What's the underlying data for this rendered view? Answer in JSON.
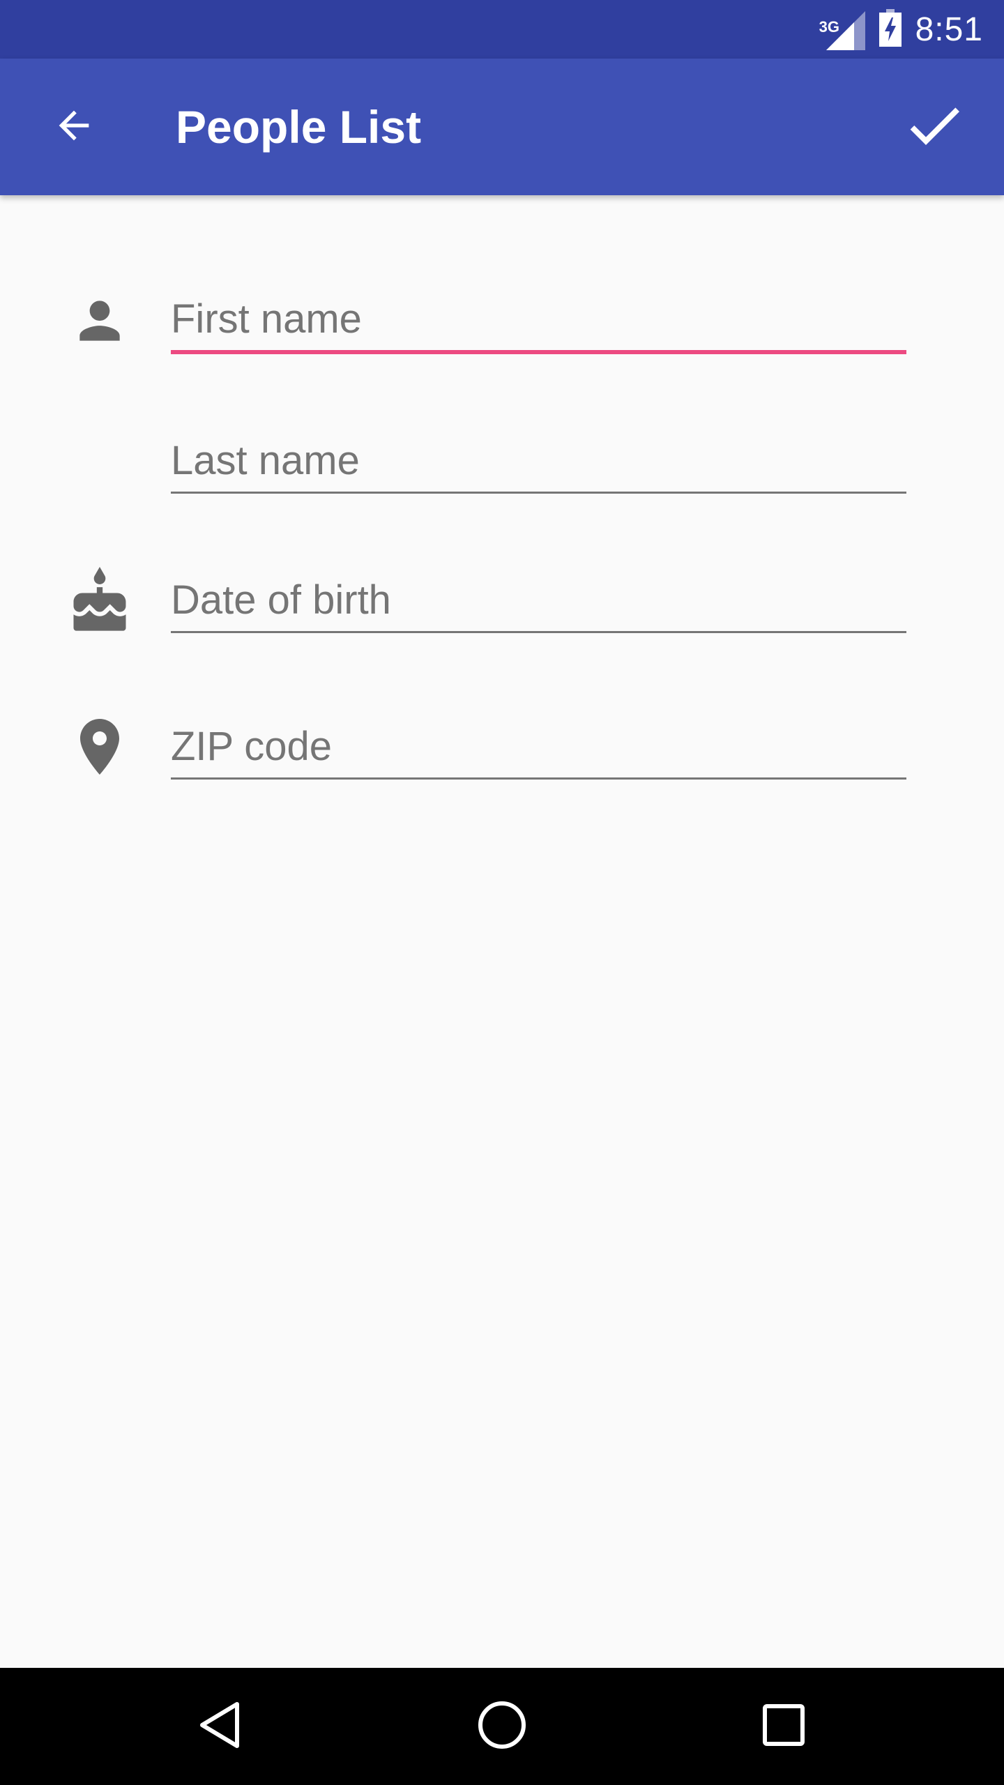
{
  "status_bar": {
    "network": "3G",
    "time": "8:51",
    "icons": [
      "signal-icon",
      "battery-charging-icon"
    ]
  },
  "app_bar": {
    "title": "People List",
    "back_icon": "arrow-back-icon",
    "confirm_icon": "check-icon"
  },
  "form": {
    "first_name": {
      "placeholder": "First name",
      "value": "",
      "icon": "person-icon"
    },
    "last_name": {
      "placeholder": "Last name",
      "value": ""
    },
    "date_of_birth": {
      "placeholder": "Date of birth",
      "value": "",
      "icon": "cake-icon"
    },
    "zip_code": {
      "placeholder": "ZIP code",
      "value": "",
      "icon": "location-pin-icon"
    }
  },
  "nav_bar": {
    "icons": [
      "back-triangle-icon",
      "home-circle-icon",
      "recents-square-icon"
    ]
  },
  "colors": {
    "status_bar": "#303f9f",
    "app_bar": "#3f51b5",
    "accent": "#e91e63",
    "icon_gray": "#666666"
  }
}
